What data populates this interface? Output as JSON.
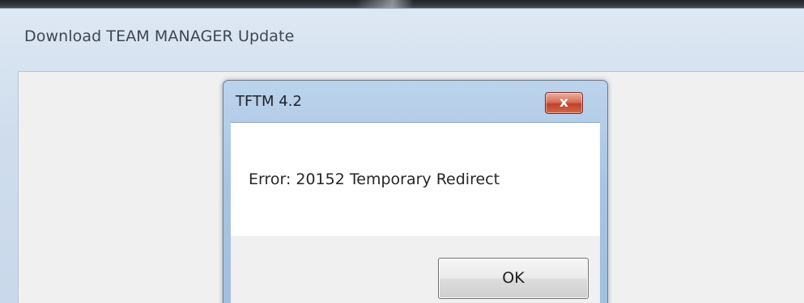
{
  "parent_window": {
    "title": "Download TEAM MANAGER Update"
  },
  "dialog": {
    "title": "TFTM 4.2",
    "close_glyph": "x",
    "close_icon": "close-icon",
    "message": "Error: 20152 Temporary Redirect",
    "ok_label": "OK"
  },
  "colors": {
    "close_button": "#c3402a",
    "title_bar": "#a9c4e2"
  }
}
